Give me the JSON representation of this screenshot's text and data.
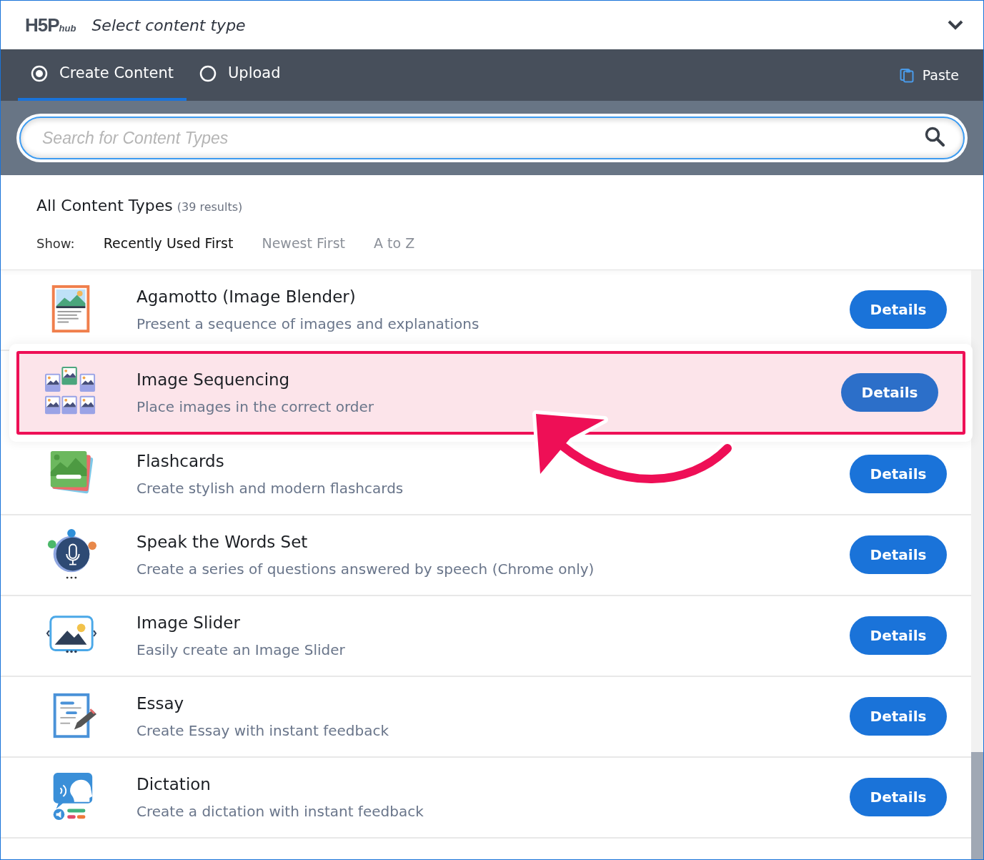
{
  "header": {
    "logo": "H5P",
    "logo_suffix": "hub",
    "title": "Select content type"
  },
  "tabs": [
    {
      "label": "Create Content",
      "selected": true
    },
    {
      "label": "Upload",
      "selected": false
    }
  ],
  "paste": "Paste",
  "search": {
    "placeholder": "Search for Content Types"
  },
  "heading": {
    "title": "All Content Types",
    "count": "(39 results)"
  },
  "show_label": "Show:",
  "sort_options": [
    {
      "label": "Recently Used First",
      "selected": true
    },
    {
      "label": "Newest First",
      "selected": false
    },
    {
      "label": "A to Z",
      "selected": false
    }
  ],
  "items": [
    {
      "title": "Agamotto (Image Blender)",
      "description": "Present a sequence of images and explanations",
      "button": "Details",
      "highlighted": false
    },
    {
      "title": "Image Sequencing",
      "description": "Place images in the correct order",
      "button": "Details",
      "highlighted": true
    },
    {
      "title": "Flashcards",
      "description": "Create stylish and modern flashcards",
      "button": "Details",
      "highlighted": false
    },
    {
      "title": "Speak the Words Set",
      "description": "Create a series of questions answered by speech (Chrome only)",
      "button": "Details",
      "highlighted": false
    },
    {
      "title": "Image Slider",
      "description": "Easily create an Image Slider",
      "button": "Details",
      "highlighted": false
    },
    {
      "title": "Essay",
      "description": "Create Essay with instant feedback",
      "button": "Details",
      "highlighted": false
    },
    {
      "title": "Dictation",
      "description": "Create a dictation with instant feedback",
      "button": "Details",
      "highlighted": false
    }
  ]
}
